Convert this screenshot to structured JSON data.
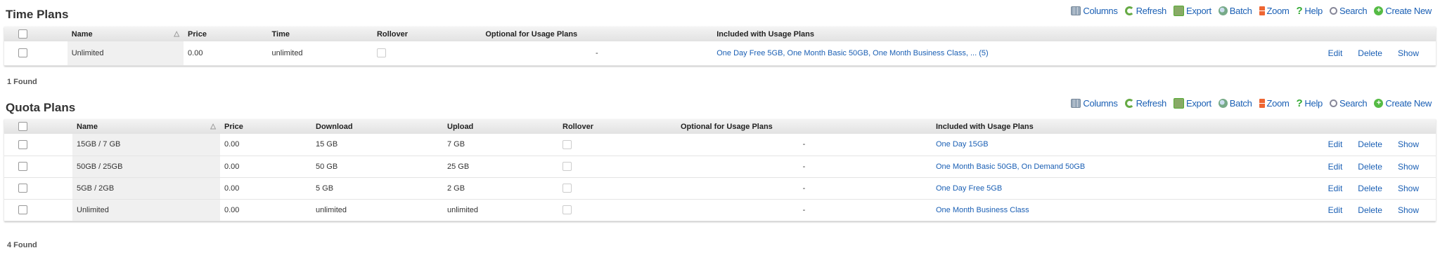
{
  "toolbar_items": [
    {
      "label": "Columns",
      "icon": "columns-icon"
    },
    {
      "label": "Refresh",
      "icon": "refresh-icon"
    },
    {
      "label": "Export",
      "icon": "export-icon"
    },
    {
      "label": "Batch",
      "icon": "batch-icon"
    },
    {
      "label": "Zoom",
      "icon": "zoom-icon"
    },
    {
      "label": "Help",
      "icon": "help-icon"
    },
    {
      "label": "Search",
      "icon": "search-icon"
    },
    {
      "label": "Create New",
      "icon": "create-new-icon"
    }
  ],
  "time_plans": {
    "title": "Time Plans",
    "headers": {
      "name": "Name",
      "price": "Price",
      "time": "Time",
      "rollover": "Rollover",
      "optional": "Optional for Usage Plans",
      "included": "Included with Usage Plans"
    },
    "rows": [
      {
        "name": "Unlimited",
        "price": "0.00",
        "time": "unlimited",
        "optional": "-",
        "included": "One Day Free 5GB, One Month Basic 50GB, One Month Business Class, ... (5)"
      }
    ],
    "found": "1 Found"
  },
  "quota_plans": {
    "title": "Quota Plans",
    "headers": {
      "name": "Name",
      "price": "Price",
      "download": "Download",
      "upload": "Upload",
      "rollover": "Rollover",
      "optional": "Optional for Usage Plans",
      "included": "Included with Usage Plans"
    },
    "rows": [
      {
        "name": "15GB / 7 GB",
        "price": "0.00",
        "download": "15 GB",
        "upload": "7 GB",
        "optional": "-",
        "included": "One Day 15GB"
      },
      {
        "name": "50GB / 25GB",
        "price": "0.00",
        "download": "50 GB",
        "upload": "25 GB",
        "optional": "-",
        "included": "One Month Basic 50GB, On Demand 50GB"
      },
      {
        "name": "5GB / 2GB",
        "price": "0.00",
        "download": "5 GB",
        "upload": "2 GB",
        "optional": "-",
        "included": "One Day Free 5GB"
      },
      {
        "name": "Unlimited",
        "price": "0.00",
        "download": "unlimited",
        "upload": "unlimited",
        "optional": "-",
        "included": "One Month Business Class"
      }
    ],
    "found": "4 Found"
  },
  "row_actions": {
    "edit": "Edit",
    "delete": "Delete",
    "show": "Show"
  }
}
